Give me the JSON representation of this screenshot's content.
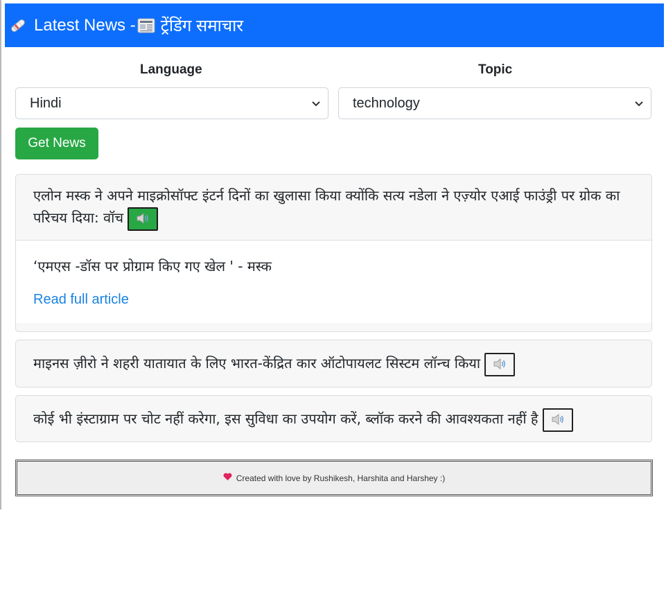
{
  "header": {
    "title": "Latest News - ",
    "subtitle": "ट्रेंडिंग समाचार",
    "icon": "rolled-newspaper-icon",
    "subtitle_icon": "newspaper-icon",
    "bg_color": "#0d6efd"
  },
  "filters": {
    "language": {
      "label": "Language",
      "selected": "Hindi"
    },
    "topic": {
      "label": "Topic",
      "selected": "technology"
    },
    "submit_label": "Get News"
  },
  "articles": [
    {
      "title": "एलोन मस्क ने अपने माइक्रोसॉफ्ट इंटर्न दिनों का खुलासा किया क्योंकि सत्य नडेला ने एज़्योर एआई फाउंड्री पर ग्रोक का परिचय दिया: वॉच",
      "expanded": true,
      "summary": "‘एमएस -डॉस पर प्रोग्राम किए गए खेल ' - मस्क",
      "link_label": "Read full article",
      "speaker_active": true
    },
    {
      "title": "माइनस ज़ीरो ने शहरी यातायात के लिए भारत-केंद्रित कार ऑटोपायलट सिस्टम लॉन्च किया",
      "expanded": false,
      "speaker_active": false
    },
    {
      "title": "कोई भी इंस्टाग्राम पर चोट नहीं करेगा, इस सुविधा का उपयोग करें, ब्लॉक करने की आवश्यकता नहीं है",
      "expanded": false,
      "speaker_active": false
    }
  ],
  "footer": {
    "text": "Created with love by Rushikesh, Harshita and Harshey :)",
    "icon": "heart-icon"
  },
  "colors": {
    "primary": "#0d6efd",
    "success": "#28a745",
    "link": "#1a82e2"
  }
}
